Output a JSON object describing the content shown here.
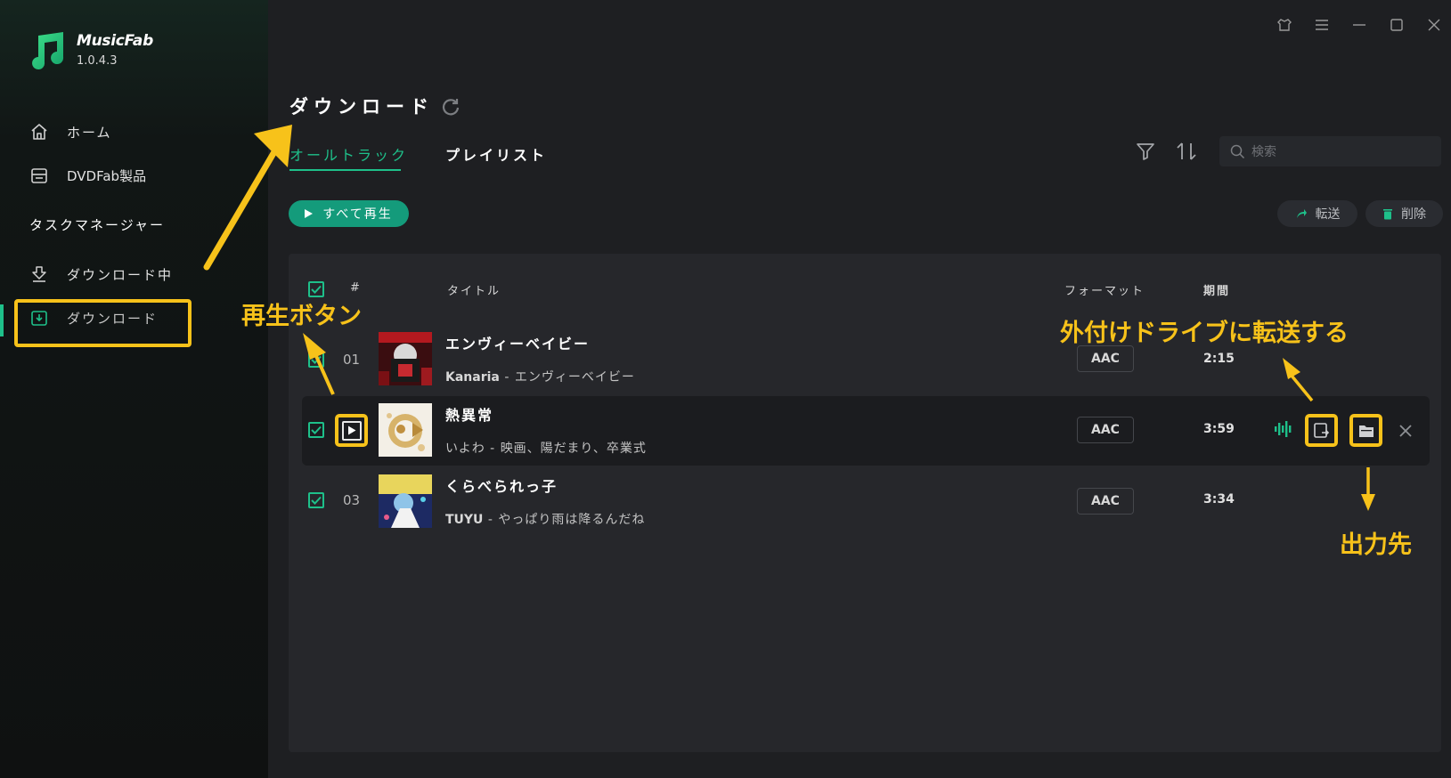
{
  "app": {
    "name": "MusicFab",
    "version": "1.0.4.3"
  },
  "sidebar": {
    "items": [
      {
        "label": "ホーム",
        "icon": "home-icon"
      },
      {
        "label": "DVDFab製品",
        "icon": "dvd-drive-icon"
      }
    ],
    "section_title": "タスクマネージャー",
    "tasks": [
      {
        "label": "ダウンロード中",
        "icon": "downloading-icon"
      },
      {
        "label": "ダウンロード",
        "icon": "downloaded-icon",
        "active": true
      }
    ]
  },
  "header": {
    "title": "ダウンロード",
    "tabs": [
      {
        "label": "オールトラック",
        "active": true
      },
      {
        "label": "プレイリスト",
        "active": false
      }
    ],
    "search_placeholder": "検索"
  },
  "toolbar": {
    "play_all": "すべて再生",
    "transfer": "転送",
    "delete": "削除"
  },
  "table": {
    "columns": {
      "index": "#",
      "title": "タイトル",
      "format": "フォーマット",
      "duration": "期間"
    },
    "rows": [
      {
        "index": "01",
        "title": "エンヴィーベイビー",
        "artist": "Kanaria",
        "album": "エンヴィーベイビー",
        "format": "AAC",
        "duration": "2:15"
      },
      {
        "index": "",
        "title": "熱異常",
        "artist": "いよわ",
        "album": "映画、陽だまり、卒業式",
        "format": "AAC",
        "duration": "3:59",
        "highlighted": true
      },
      {
        "index": "03",
        "title": "くらべられっ子",
        "artist": "TUYU",
        "album": "やっぱり雨は降るんだね",
        "format": "AAC",
        "duration": "3:34"
      }
    ]
  },
  "annotations": {
    "play_button": "再生ボタン",
    "transfer_external": "外付けドライブに転送する",
    "output_folder": "出力先"
  },
  "colors": {
    "accent": "#1ec08a",
    "accent_button": "#149b7b",
    "highlight": "#f7c21a",
    "sidebar_bg": "#0f1111",
    "main_bg": "#1e1f22",
    "panel_bg": "#26272b"
  }
}
